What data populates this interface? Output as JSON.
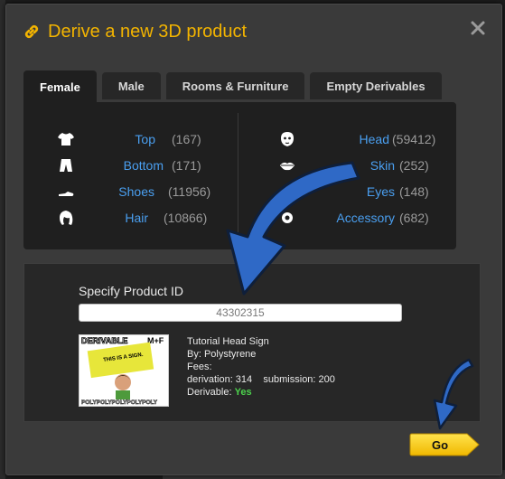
{
  "dialog": {
    "title": "Derive a new 3D product"
  },
  "tabs": [
    {
      "label": "Female",
      "active": true
    },
    {
      "label": "Male",
      "active": false
    },
    {
      "label": "Rooms & Furniture",
      "active": false
    },
    {
      "label": "Empty Derivables",
      "active": false
    }
  ],
  "categories": {
    "left": [
      {
        "label": "Top",
        "count": "(167)",
        "icon": "shirt-icon"
      },
      {
        "label": "Bottom",
        "count": "(171)",
        "icon": "pants-icon"
      },
      {
        "label": "Shoes",
        "count": "(11956)",
        "icon": "shoe-icon"
      },
      {
        "label": "Hair",
        "count": "(10866)",
        "icon": "hair-icon"
      }
    ],
    "right": [
      {
        "label": "Head",
        "count": "(59412)",
        "icon": "head-icon"
      },
      {
        "label": "Skin",
        "count": "(252)",
        "icon": "lips-icon"
      },
      {
        "label": "Eyes",
        "count": "(148)",
        "icon": "eye-icon"
      },
      {
        "label": "Accessory",
        "count": "(682)",
        "icon": "accessory-icon"
      }
    ]
  },
  "product": {
    "id_label": "Specify Product ID",
    "id_value": "43302315",
    "name": "Tutorial Head Sign",
    "by": "By: Polystyrene",
    "fees_label": "Fees:",
    "derivation": "derivation: 314",
    "submission": "submission: 200",
    "derivable_label": "Derivable:",
    "derivable_value": "Yes",
    "thumbnail": {
      "top_left": "DERIVABLE",
      "top_right": "M+F",
      "sign": "THIS IS A SIGN.",
      "bottom": "POLYPOLYPOLYPOLYPOLY"
    }
  },
  "go_label": "Go",
  "colors": {
    "title": "#f3b400",
    "link": "#4a9ff0",
    "accent_go": "#f5c400",
    "arrow": "#2f69c6"
  }
}
